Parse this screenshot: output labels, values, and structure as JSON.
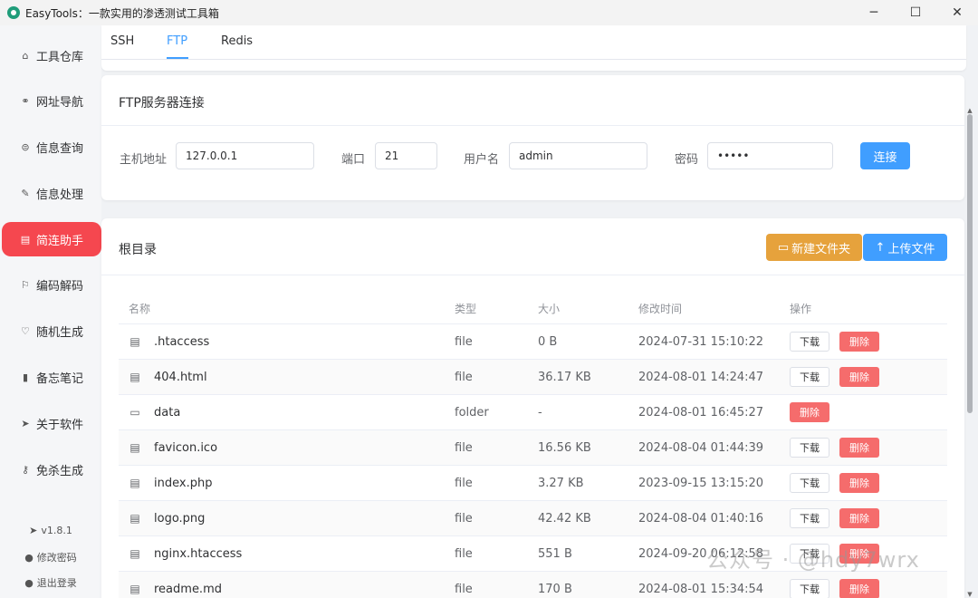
{
  "window": {
    "title": "EasyTools：一款实用的渗透测试工具箱",
    "minimize": "─",
    "maximize": "☐",
    "close": "✕"
  },
  "sidebar": {
    "items": [
      {
        "label": "工具仓库",
        "icon": "briefcase-icon",
        "glyph": "⌂"
      },
      {
        "label": "网址导航",
        "icon": "link-icon",
        "glyph": "⚭"
      },
      {
        "label": "信息查询",
        "icon": "search-icon",
        "glyph": "⊜"
      },
      {
        "label": "信息处理",
        "icon": "edit-icon",
        "glyph": "✎"
      },
      {
        "label": "简连助手",
        "icon": "note-icon",
        "glyph": "▤",
        "active": true
      },
      {
        "label": "编码解码",
        "icon": "flag-icon",
        "glyph": "⚐"
      },
      {
        "label": "随机生成",
        "icon": "chat-icon",
        "glyph": "♡"
      },
      {
        "label": "备忘笔记",
        "icon": "notebook-icon",
        "glyph": "▮"
      },
      {
        "label": "关于软件",
        "icon": "send-icon",
        "glyph": "➤"
      },
      {
        "label": "免杀生成",
        "icon": "key-icon",
        "glyph": "⚷"
      }
    ],
    "version": "v1.8.1",
    "change_password": "修改密码",
    "logout": "退出登录"
  },
  "tabs": [
    {
      "label": "SSH"
    },
    {
      "label": "FTP",
      "active": true
    },
    {
      "label": "Redis"
    }
  ],
  "connection": {
    "title": "FTP服务器连接",
    "host_label": "主机地址",
    "host_value": "127.0.0.1",
    "port_label": "端口",
    "port_value": "21",
    "user_label": "用户名",
    "user_value": "admin",
    "password_label": "密码",
    "password_value": "•••••",
    "connect_button": "连接"
  },
  "files": {
    "path": "根目录",
    "new_folder_button": "新建文件夹",
    "upload_button": "上传文件",
    "columns": {
      "name": "名称",
      "type": "类型",
      "size": "大小",
      "time": "修改时间",
      "ops": "操作"
    },
    "download_label": "下载",
    "delete_label": "删除",
    "rows": [
      {
        "name": ".htaccess",
        "type": "file",
        "size": "0 B",
        "time": "2024-07-31 15:10:22"
      },
      {
        "name": "404.html",
        "type": "file",
        "size": "36.17 KB",
        "time": "2024-08-01 14:24:47"
      },
      {
        "name": "data",
        "type": "folder",
        "size": "-",
        "time": "2024-08-01 16:45:27"
      },
      {
        "name": "favicon.ico",
        "type": "file",
        "size": "16.56 KB",
        "time": "2024-08-04 01:44:39"
      },
      {
        "name": "index.php",
        "type": "file",
        "size": "3.27 KB",
        "time": "2023-09-15 13:15:20"
      },
      {
        "name": "logo.png",
        "type": "file",
        "size": "42.42 KB",
        "time": "2024-08-04 01:40:16"
      },
      {
        "name": "nginx.htaccess",
        "type": "file",
        "size": "551 B",
        "time": "2024-09-20 06:12:58"
      },
      {
        "name": "readme.md",
        "type": "file",
        "size": "170 B",
        "time": "2024-08-01 15:34:54"
      }
    ]
  },
  "watermark": "公众号 · @hdy7wrx"
}
